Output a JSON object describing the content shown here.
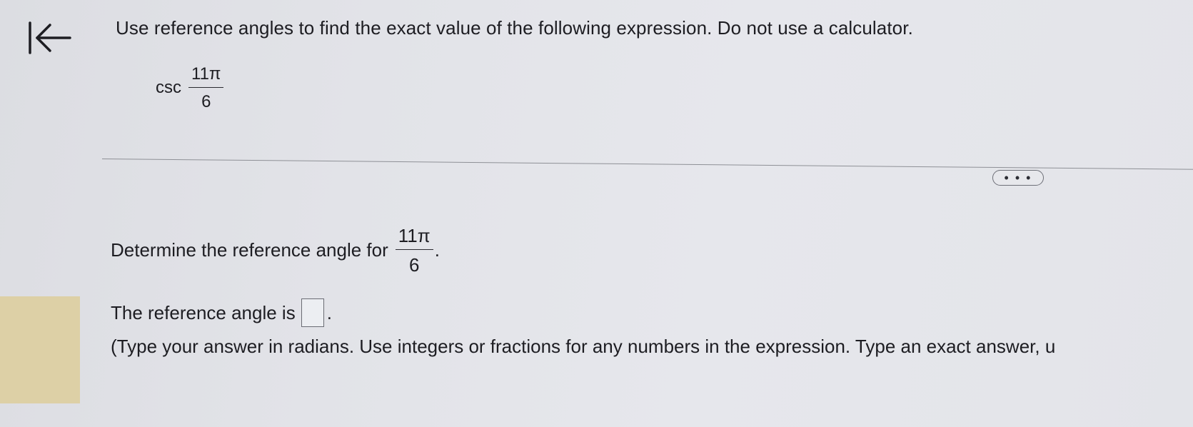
{
  "nav": {
    "back_icon": "back-to-start-icon"
  },
  "problem": {
    "prompt": "Use reference angles to find the exact value of the following expression. Do not use a calculator.",
    "function": "csc",
    "numerator": "11π",
    "denominator": "6"
  },
  "toolbar": {
    "more_label": "• • •"
  },
  "step": {
    "question_prefix": "Determine the reference angle for",
    "numerator": "11π",
    "denominator": "6",
    "question_suffix": ".",
    "answer_prefix": "The reference angle is",
    "answer_value": "",
    "answer_suffix": ".",
    "instructions": "(Type your answer in radians. Use integers or fractions for any numbers in the expression. Type an exact answer, u"
  },
  "colors": {
    "highlight": "#ddd0a6",
    "background": "#e3e4e9"
  }
}
